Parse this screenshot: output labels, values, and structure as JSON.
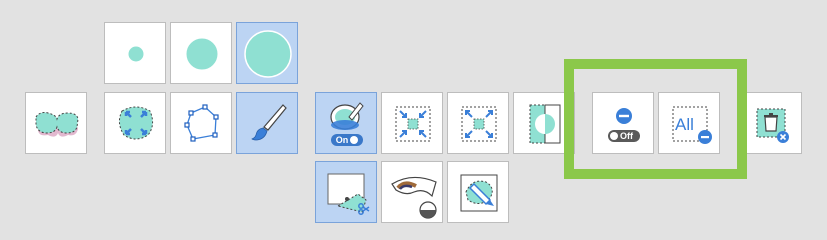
{
  "toolbar": {
    "buttons": [
      {
        "id": "mask-overlay",
        "icon": "mask-overlay-icon",
        "selected": false
      },
      {
        "id": "brush-small",
        "icon": "brush-small-icon",
        "selected": false
      },
      {
        "id": "brush-medium",
        "icon": "brush-medium-icon",
        "selected": false
      },
      {
        "id": "brush-large",
        "icon": "brush-large-icon",
        "selected": true
      },
      {
        "id": "auto-select",
        "icon": "auto-select-icon",
        "selected": false
      },
      {
        "id": "polygon-lasso",
        "icon": "polygon-lasso-icon",
        "selected": false
      },
      {
        "id": "paint-brush",
        "icon": "paint-brush-icon",
        "selected": true
      },
      {
        "id": "mask-toggle",
        "icon": "mask-paint-icon",
        "selected": true
      },
      {
        "id": "shrink",
        "icon": "shrink-selection-icon",
        "selected": false
      },
      {
        "id": "grow",
        "icon": "grow-selection-icon",
        "selected": false
      },
      {
        "id": "invert",
        "icon": "invert-mask-icon",
        "selected": false
      },
      {
        "id": "subtract-off",
        "icon": "subtract-icon",
        "selected": false
      },
      {
        "id": "remove-all",
        "icon": "remove-all-icon",
        "selected": false
      },
      {
        "id": "delete-mask",
        "icon": "delete-mask-icon",
        "selected": false
      },
      {
        "id": "crop-cut",
        "icon": "crop-cut-icon",
        "selected": true
      },
      {
        "id": "eye-mask",
        "icon": "eye-mask-icon",
        "selected": false
      },
      {
        "id": "erase-brush",
        "icon": "erase-brush-icon",
        "selected": false
      }
    ],
    "mask_toggle_label": "On",
    "subtract_toggle_label": "Off",
    "remove_all_label": "All"
  },
  "colors": {
    "background": "#e2e2e2",
    "selected_fill": "#bcd4f3",
    "mask_teal": "#8fe0d2",
    "accent_blue": "#3a7fd8",
    "highlight_green": "#8bc84a"
  }
}
